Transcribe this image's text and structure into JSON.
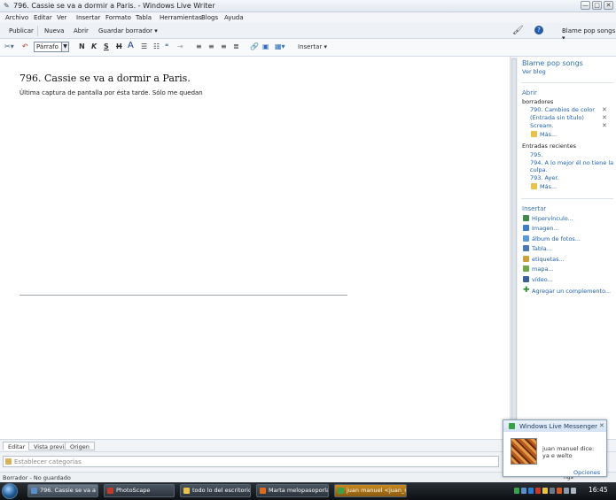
{
  "window": {
    "title": "796. Cassie se va a dormir a Paris. - Windows Live Writer",
    "min": "—",
    "max": "□",
    "close": "✕"
  },
  "menu": [
    "Archivo",
    "Editar",
    "Ver",
    "Insertar",
    "Formato",
    "Tabla",
    "Herramientas",
    "Blogs",
    "Ayuda"
  ],
  "commands": {
    "publish": "Publicar",
    "new": "Nueva",
    "open": "Abrir",
    "save_draft": "Guardar borrador ▾",
    "blog_selector": "Blame pop songs ▾"
  },
  "format": {
    "style_value": "Párrafo",
    "bold": "N",
    "italic": "K",
    "underline": "S",
    "strike": "H",
    "font_color": "A",
    "insert": "Insertar ▾"
  },
  "post": {
    "title": "796. Cassie se va a dormir a Paris.",
    "body": "Última captura de pantalla por ésta tarde. Sólo me quedan"
  },
  "sidebar": {
    "blog_name": "Blame pop songs",
    "view_blog": "Ver blog",
    "open_heading": "Abrir",
    "drafts_heading": "borradores",
    "drafts": [
      "790. Cambios de color",
      "(Entrada sin título)",
      "Scream."
    ],
    "drafts_more": "Más...",
    "recent_heading": "Entradas recientes",
    "recent": [
      "795.",
      "794. A lo mejor él no tiene la",
      "culpa.",
      "793. Ayer."
    ],
    "recent_more": "Más...",
    "insert_heading": "Insertar",
    "insert_items": [
      {
        "label": "Hipervínculo...",
        "icon": "link-icon"
      },
      {
        "label": "Imagen...",
        "icon": "image-icon"
      },
      {
        "label": "álbum de fotos...",
        "icon": "photo-album-icon"
      },
      {
        "label": "Tabla...",
        "icon": "table-icon"
      },
      {
        "label": "etiquetas...",
        "icon": "tags-icon"
      },
      {
        "label": "mapa...",
        "icon": "map-icon"
      },
      {
        "label": "vídeo...",
        "icon": "video-icon"
      }
    ],
    "add_plugin": "Agregar un complemento..."
  },
  "tabs": [
    "Editar",
    "Vista previa",
    "Origen"
  ],
  "category_placeholder": "Establecer categorías",
  "status": {
    "text": "Borrador - No guardado",
    "right_text": "ngs"
  },
  "taskbar": {
    "tasks": [
      {
        "label": "796. Cassie se va a d...",
        "active": true,
        "color": "#5a8ec8"
      },
      {
        "label": "PhotoScape",
        "active": false,
        "color": "#c43a2a"
      },
      {
        "label": "todo lo del escritorio",
        "active": false,
        "color": "#e8c24a"
      },
      {
        "label": "Marta melopasoporlar...",
        "active": false,
        "color": "#e06a1c"
      },
      {
        "label": "juan manuel <juan_m...",
        "active": false,
        "color": "#3aa04a"
      }
    ],
    "clock": "16:45"
  },
  "toast": {
    "title": "Windows Live Messenger",
    "sender": "juan manuel dice:",
    "message": "ya e welto",
    "options": "Opciones"
  }
}
